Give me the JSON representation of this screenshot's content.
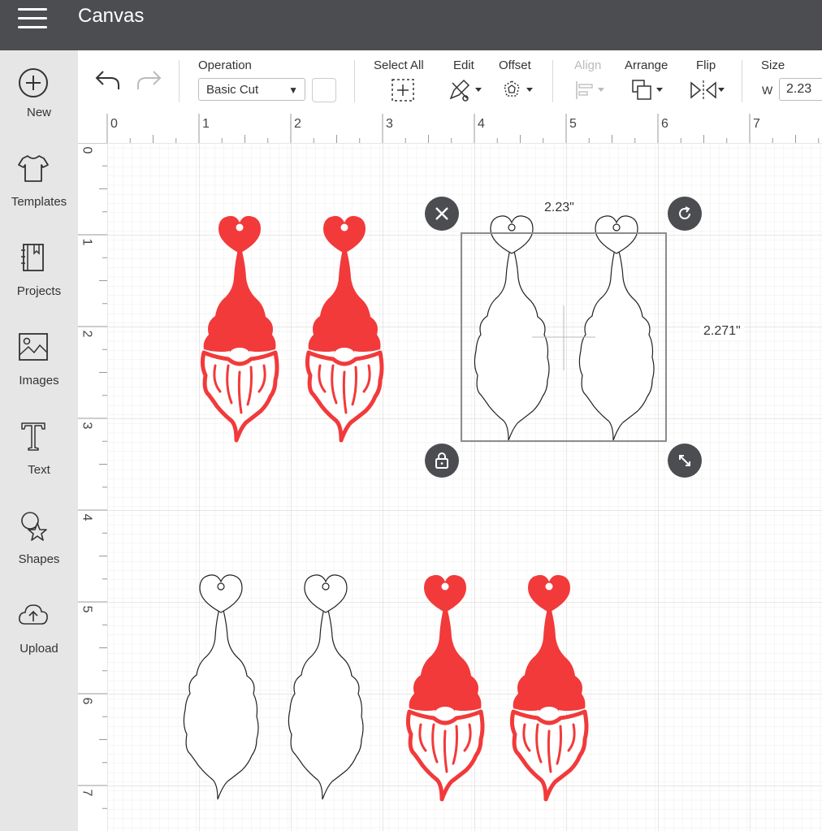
{
  "app": {
    "title": "Canvas"
  },
  "sidebar": {
    "items": [
      {
        "label": "New",
        "icon": "plus-circle-icon"
      },
      {
        "label": "Templates",
        "icon": "tshirt-icon"
      },
      {
        "label": "Projects",
        "icon": "notebook-icon"
      },
      {
        "label": "Images",
        "icon": "image-icon"
      },
      {
        "label": "Text",
        "icon": "text-t-icon"
      },
      {
        "label": "Shapes",
        "icon": "shapes-icon"
      },
      {
        "label": "Upload",
        "icon": "cloud-upload-icon"
      }
    ]
  },
  "toolbar": {
    "operation_label": "Operation",
    "operation_value": "Basic Cut",
    "select_all_label": "Select All",
    "edit_label": "Edit",
    "offset_label": "Offset",
    "align_label": "Align",
    "arrange_label": "Arrange",
    "flip_label": "Flip",
    "size_label": "Size",
    "size_w_label": "W",
    "size_w_value": "2.23"
  },
  "rulers": {
    "top": [
      "0",
      "1",
      "2",
      "3",
      "4",
      "5",
      "6",
      "7"
    ],
    "left": [
      "0",
      "1",
      "2",
      "3",
      "4",
      "5",
      "6",
      "7"
    ]
  },
  "selection": {
    "width_label": "2.23\"",
    "height_label": "2.271\""
  },
  "colors": {
    "topbar": "#4b4d50",
    "sidebar": "#e6e6e6",
    "gnome_red": "#f23a3a",
    "grid": "#dcdcdc"
  }
}
